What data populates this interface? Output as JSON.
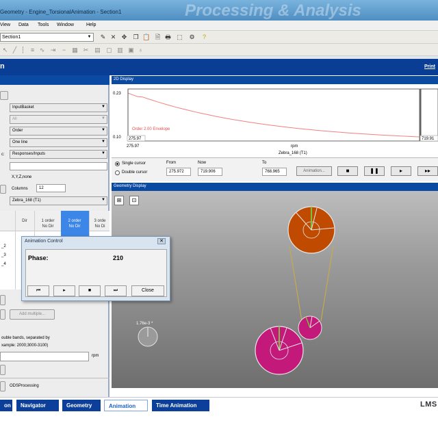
{
  "window": {
    "title": "Geometry - Engine_TorsionalAnimation - Section1",
    "watermark": "Processing & Analysis"
  },
  "menu": [
    "View",
    "Data",
    "Tools",
    "Window",
    "Help"
  ],
  "toolbar": {
    "section_combo": "Section1"
  },
  "header": {
    "title": "n",
    "print_link": "Print"
  },
  "left_panel": {
    "selects": [
      "InputBasket",
      "All",
      "Order",
      "One line",
      "Responses/Inputs",
      "Zebra_168 (T1)"
    ],
    "label_colon": "c:",
    "xyz_value": "X,Y,Z,none",
    "columns_label": "Columns",
    "columns_value": "12",
    "grid": {
      "headers": [
        "Dir",
        "1 order\nNo Dir",
        "2 order\nNo Dir",
        "3 orde\nNo Di"
      ],
      "row_labels": [
        "_2",
        "_3",
        "_4"
      ]
    },
    "add_multiple": "Add multiple...",
    "bands_hint_1": "ouble bands, separated by",
    "bands_hint_2": "xample: 2000;3000-3100)",
    "rpm_unit": "rpm",
    "ods_label": "ODSProcessing"
  },
  "display_2d": {
    "header": "2D Display",
    "y_top": "0.23",
    "y_bottom": "0.10",
    "x_left": "275.97",
    "x_label_unit": "rpm",
    "x_label": "Zebra_168 (T1)",
    "cursor_left_readout": "275.97",
    "cursor_right_readout": "719.91",
    "legend": "Order 2.00 Envelope"
  },
  "cursor_bar": {
    "single": "Single cursor",
    "double": "Double cursor",
    "from_label": "From",
    "from_value": "275.972",
    "now_label": "Now",
    "now_value": "719.906",
    "to_label": "To",
    "to_value": "768.965",
    "animation_btn": "Animation..."
  },
  "geometry": {
    "header": "Geometry Display",
    "small_label": "1.76e-3 *"
  },
  "dialog": {
    "title": "Animation Control",
    "phase_label": "Phase:",
    "phase_value": "210",
    "close": "Close"
  },
  "nav": [
    "on",
    "Navigator",
    "Geometry",
    "Animation",
    "Time Animation"
  ],
  "brand": "LMS",
  "colors": {
    "header_blue": "#0a3d94",
    "curve": "#f08080",
    "pulley_top": "#c04a00",
    "pulley_bottom": "#c2197a"
  }
}
